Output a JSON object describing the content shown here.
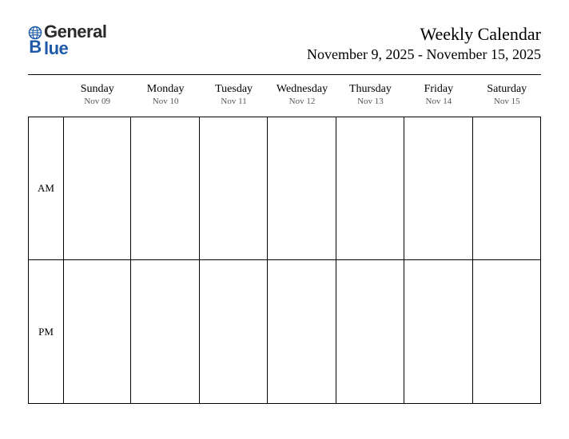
{
  "logo": {
    "word1": "General",
    "word2": "Blue",
    "color_general": "#2a2a2a",
    "color_blue": "#1e5aa8"
  },
  "title": "Weekly Calendar",
  "date_range": "November 9, 2025 - November 15, 2025",
  "periods": {
    "am": "AM",
    "pm": "PM"
  },
  "days": [
    {
      "name": "Sunday",
      "date": "Nov 09"
    },
    {
      "name": "Monday",
      "date": "Nov 10"
    },
    {
      "name": "Tuesday",
      "date": "Nov 11"
    },
    {
      "name": "Wednesday",
      "date": "Nov 12"
    },
    {
      "name": "Thursday",
      "date": "Nov 13"
    },
    {
      "name": "Friday",
      "date": "Nov 14"
    },
    {
      "name": "Saturday",
      "date": "Nov 15"
    }
  ]
}
